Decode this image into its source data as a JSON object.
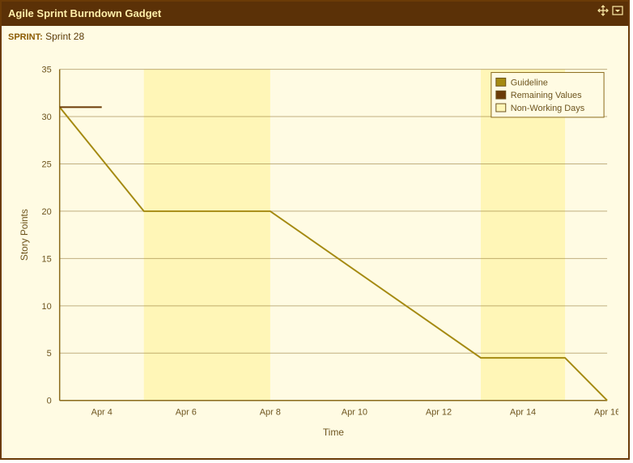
{
  "header": {
    "title": "Agile Sprint Burndown Gadget",
    "move_tooltip": "Move",
    "menu_tooltip": "Menu"
  },
  "sprint": {
    "label": "SPRINT:",
    "name": "Sprint 28"
  },
  "chart_data": {
    "type": "line",
    "title": "",
    "xlabel": "Time",
    "ylabel": "Story Points",
    "ylim": [
      0,
      35
    ],
    "y_ticks": [
      0,
      5,
      10,
      15,
      20,
      25,
      30,
      35
    ],
    "x_categories_index": [
      0,
      1,
      2,
      3,
      4,
      5,
      6,
      7,
      8,
      9,
      10,
      11,
      12,
      13
    ],
    "x_tick_labels": [
      "Apr 4",
      "Apr 6",
      "Apr 8",
      "Apr 10",
      "Apr 12",
      "Apr 14",
      "Apr 16"
    ],
    "x_tick_positions": [
      1,
      3,
      5,
      7,
      9,
      11,
      13
    ],
    "non_working_day_ranges": [
      [
        2,
        5
      ],
      [
        10,
        12
      ]
    ],
    "series": [
      {
        "name": "Guideline",
        "color": "#a58a12",
        "points": [
          [
            0,
            31
          ],
          [
            2,
            20
          ],
          [
            5,
            20
          ],
          [
            10,
            4.5
          ],
          [
            12,
            4.5
          ],
          [
            13,
            0
          ]
        ]
      },
      {
        "name": "Remaining Values",
        "color": "#6b3b07",
        "points": [
          [
            0,
            31
          ],
          [
            1,
            31
          ]
        ]
      }
    ],
    "legend": {
      "position": "top-right",
      "entries": [
        "Guideline",
        "Remaining Values",
        "Non-Working Days"
      ]
    }
  }
}
